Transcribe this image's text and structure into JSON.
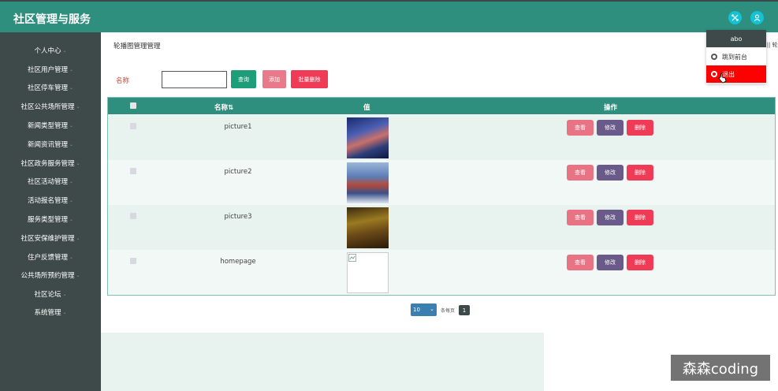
{
  "header": {
    "title": "社区管理与服务"
  },
  "sidebar": {
    "items": [
      {
        "label": "个人中心"
      },
      {
        "label": "社区用户管理"
      },
      {
        "label": "社区停车管理"
      },
      {
        "label": "社区公共场所管理"
      },
      {
        "label": "新闻类型管理"
      },
      {
        "label": "新闻资讯管理"
      },
      {
        "label": "社区政务服务管理"
      },
      {
        "label": "社区活动管理"
      },
      {
        "label": "活动报名管理"
      },
      {
        "label": "服务类型管理"
      },
      {
        "label": "社区安保维护管理"
      },
      {
        "label": "住户反馈管理"
      },
      {
        "label": "公共场所预约管理"
      },
      {
        "label": "社区论坛"
      },
      {
        "label": "系统管理"
      }
    ]
  },
  "page": {
    "title": "轮播图管理管理",
    "breadcrumb": "|| 轮播图管理",
    "search_label": "名称",
    "search_value": "",
    "query_button": "查询",
    "add_button": "添加",
    "batch_delete_button": "批量删除"
  },
  "table": {
    "headers": {
      "name": "名称",
      "value": "值",
      "actions": "操作"
    },
    "rows": [
      {
        "name": "picture1",
        "image": "city-night-photo",
        "view": "查看",
        "edit": "修改",
        "delete": "删除"
      },
      {
        "name": "picture2",
        "image": "city-skyline-photo",
        "view": "查看",
        "edit": "修改",
        "delete": "删除"
      },
      {
        "name": "picture3",
        "image": "golden-city-photo",
        "view": "查看",
        "edit": "修改",
        "delete": "删除"
      },
      {
        "name": "homepage",
        "image": "broken-image",
        "view": "查看",
        "edit": "修改",
        "delete": "删除"
      }
    ]
  },
  "pagination": {
    "page_size": "10",
    "per_page_label": "条每页",
    "current_page": "1"
  },
  "user_menu": {
    "username": "abo",
    "items": [
      {
        "label": "跳到前台"
      },
      {
        "label": "退出"
      }
    ]
  },
  "watermark": "森森coding",
  "colors": {
    "primary": "#2f8f7f",
    "sidebar": "#3e4a49",
    "view": "#e87385",
    "edit": "#6a5a8a",
    "delete": "#f03b56",
    "query": "#1e9e78",
    "logout": "#ff0000"
  }
}
